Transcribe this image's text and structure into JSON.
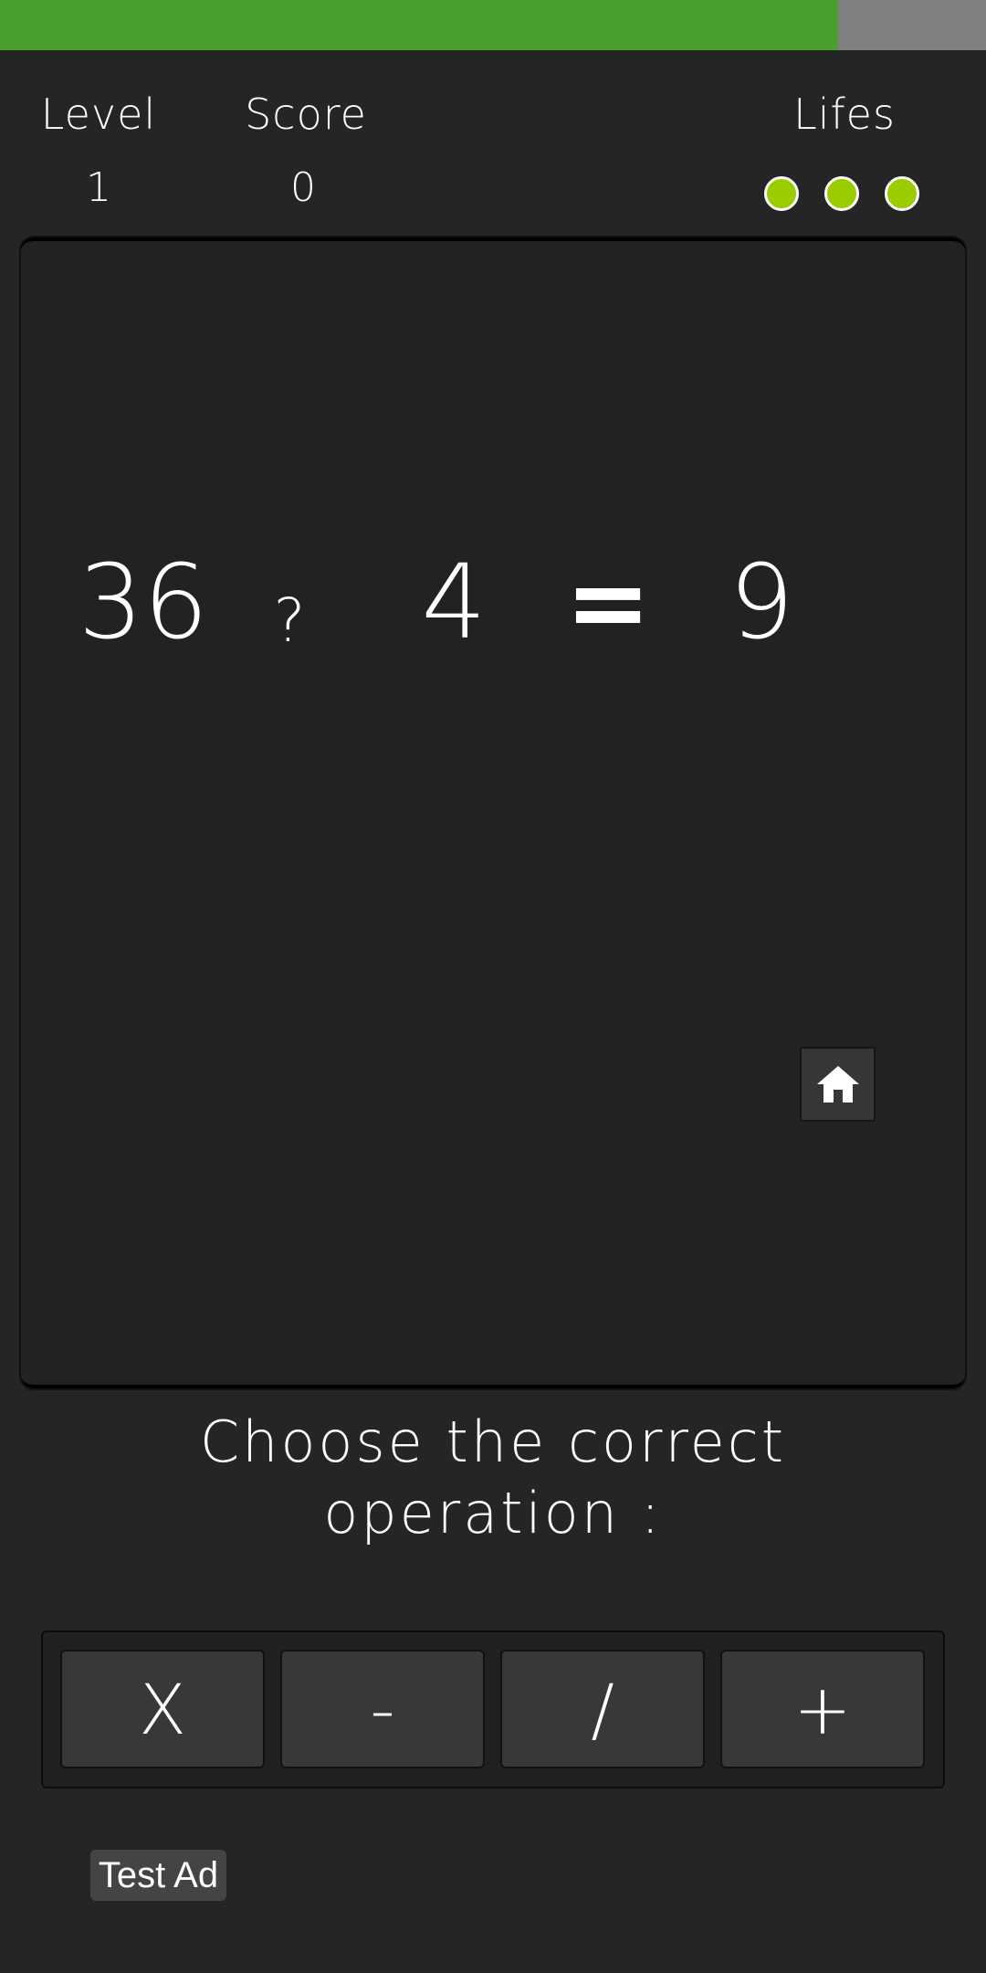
{
  "progress": {
    "percent": 85,
    "fill_color": "#4b9f2e",
    "track_color": "#808080"
  },
  "header": {
    "level_label": "Level",
    "level_value": "1",
    "score_label": "Score",
    "score_value": "0",
    "lifes_label": "Lifes",
    "lifes_count": 3,
    "life_color": "#9bcc00"
  },
  "equation": {
    "left": "36",
    "operator": "?",
    "right": "4",
    "equals": "=",
    "result": "9"
  },
  "home_button": {
    "icon": "home-icon"
  },
  "prompt": {
    "line1": "Choose the correct",
    "line2": "operation :"
  },
  "operations": [
    {
      "label": "X"
    },
    {
      "label": "-"
    },
    {
      "label": "/"
    },
    {
      "label": "+"
    }
  ],
  "ad": {
    "label": "Test Ad"
  }
}
